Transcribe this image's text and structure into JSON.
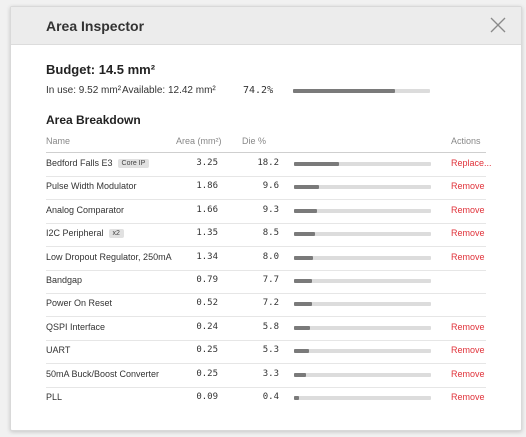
{
  "dialog": {
    "title": "Area Inspector",
    "close_icon": "close-icon"
  },
  "budget": {
    "label": "Budget: 14.5 mm²",
    "in_use": "In use: 9.52 mm²",
    "available": "Available: 12.42 mm²",
    "used_percent_text": "74.2%",
    "used_fraction": 0.742
  },
  "breakdown": {
    "title": "Area Breakdown",
    "columns": {
      "name": "Name",
      "area": "Area (mm²)",
      "die": "Die %",
      "actions": "Actions"
    },
    "rows": [
      {
        "name": "Bedford Falls E3",
        "badge": "Core IP",
        "area": "3.25",
        "die": "18.2",
        "fraction": 0.33,
        "action": "Replace..."
      },
      {
        "name": "Pulse Width Modulator",
        "badge": "",
        "area": "1.86",
        "die": "9.6",
        "fraction": 0.18,
        "action": "Remove"
      },
      {
        "name": "Analog Comparator",
        "badge": "",
        "area": "1.66",
        "die": "9.3",
        "fraction": 0.17,
        "action": "Remove"
      },
      {
        "name": "I2C Peripheral",
        "badge": "x2",
        "area": "1.35",
        "die": "8.5",
        "fraction": 0.15,
        "action": "Remove"
      },
      {
        "name": "Low Dropout Regulator, 250mA",
        "badge": "",
        "area": "1.34",
        "die": "8.0",
        "fraction": 0.14,
        "action": "Remove"
      },
      {
        "name": "Bandgap",
        "badge": "",
        "area": "0.79",
        "die": "7.7",
        "fraction": 0.13,
        "action": ""
      },
      {
        "name": "Power On Reset",
        "badge": "",
        "area": "0.52",
        "die": "7.2",
        "fraction": 0.13,
        "action": ""
      },
      {
        "name": "QSPI Interface",
        "badge": "",
        "area": "0.24",
        "die": "5.8",
        "fraction": 0.12,
        "action": "Remove"
      },
      {
        "name": "UART",
        "badge": "",
        "area": "0.25",
        "die": "5.3",
        "fraction": 0.11,
        "action": "Remove"
      },
      {
        "name": "50mA Buck/Boost Converter",
        "badge": "",
        "area": "0.25",
        "die": "3.3",
        "fraction": 0.09,
        "action": "Remove"
      },
      {
        "name": "PLL",
        "badge": "",
        "area": "0.09",
        "die": "0.4",
        "fraction": 0.04,
        "action": "Remove"
      }
    ]
  },
  "colors": {
    "accent_remove": "#e0323a",
    "bar_fill": "#7a7a7a",
    "bar_track": "#dcdcdc"
  }
}
